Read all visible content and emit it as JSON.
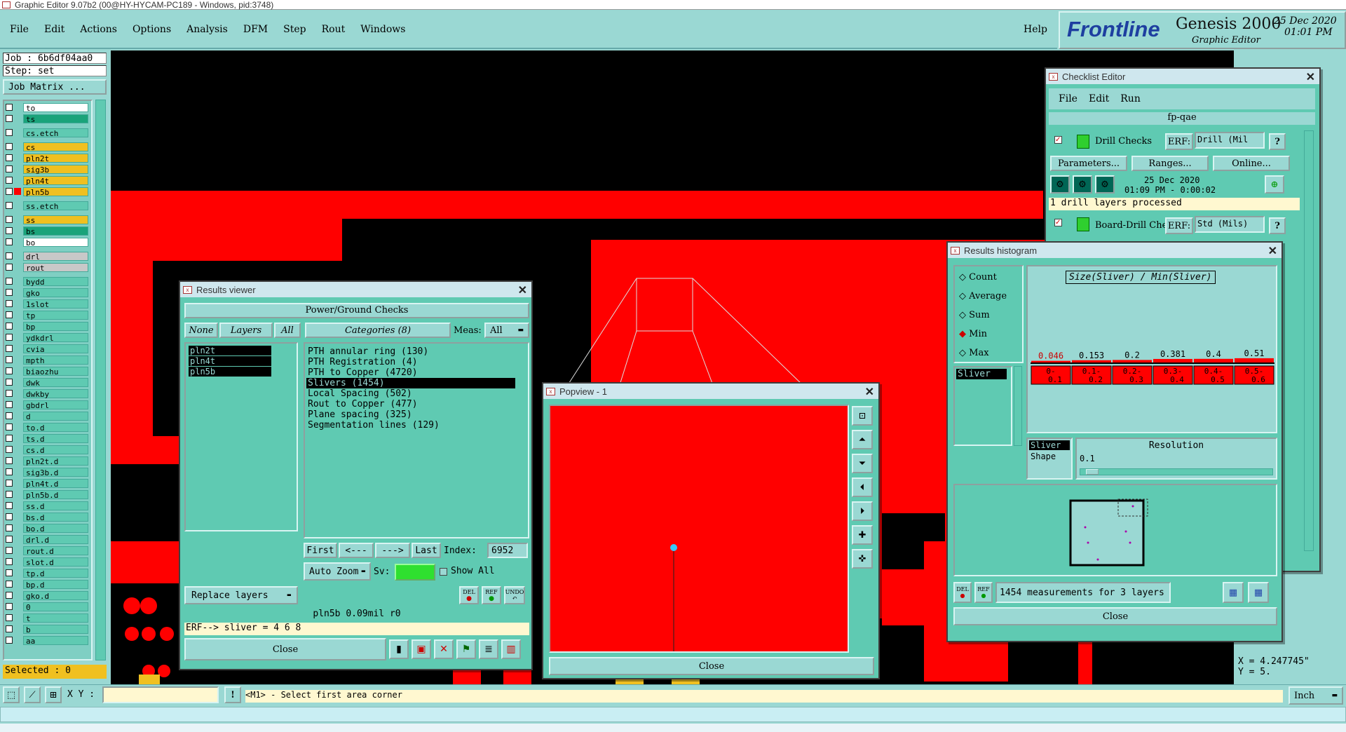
{
  "app": {
    "title": "Graphic Editor 9.07b2 (00@HY-HYCAM-PC189 - Windows, pid:3748)"
  },
  "menu": [
    "File",
    "Edit",
    "Actions",
    "Options",
    "Analysis",
    "DFM",
    "Step",
    "Rout",
    "Windows"
  ],
  "help": "Help",
  "brand": {
    "logo": "Frontline",
    "product": "Genesis 2000",
    "subtitle": "Graphic Editor",
    "date": "25 Dec 2020",
    "time": "01:01 PM"
  },
  "job": {
    "job_label": "Job : 6b6df04aa0",
    "step_label": "Step: set",
    "matrix_button": "Job Matrix ...",
    "selected": "Selected : 0"
  },
  "layers": [
    {
      "name": "to",
      "color": "#ffffff"
    },
    {
      "name": "ts",
      "color": "#1aa37a"
    },
    {
      "name": "cs.etch",
      "color": "#5fcab2"
    },
    {
      "name": "cs",
      "color": "#f0c020"
    },
    {
      "name": "pln2t",
      "color": "#f0c020"
    },
    {
      "name": "sig3b",
      "color": "#f0c020"
    },
    {
      "name": "pln4t",
      "color": "#f0c020"
    },
    {
      "name": "pln5b",
      "color": "#f0c020"
    },
    {
      "name": "ss.etch",
      "color": "#5fcab2"
    },
    {
      "name": "ss",
      "color": "#f0c020"
    },
    {
      "name": "bs",
      "color": "#1aa37a"
    },
    {
      "name": "bo",
      "color": "#ffffff"
    },
    {
      "name": "drl",
      "color": "#c8c8c8"
    },
    {
      "name": "rout",
      "color": "#c8c8c8"
    },
    {
      "name": "bydd",
      "color": "#5fcab2"
    },
    {
      "name": "gko",
      "color": "#5fcab2"
    },
    {
      "name": "1slot",
      "color": "#5fcab2"
    },
    {
      "name": "tp",
      "color": "#5fcab2"
    },
    {
      "name": "bp",
      "color": "#5fcab2"
    },
    {
      "name": "ydkdrl",
      "color": "#5fcab2"
    },
    {
      "name": "cvia",
      "color": "#5fcab2"
    },
    {
      "name": "mpth",
      "color": "#5fcab2"
    },
    {
      "name": "biaozhu",
      "color": "#5fcab2"
    },
    {
      "name": "dwk",
      "color": "#5fcab2"
    },
    {
      "name": "dwkby",
      "color": "#5fcab2"
    },
    {
      "name": "gbdrl",
      "color": "#5fcab2"
    },
    {
      "name": "d",
      "color": "#5fcab2"
    },
    {
      "name": "to.d",
      "color": "#5fcab2"
    },
    {
      "name": "ts.d",
      "color": "#5fcab2"
    },
    {
      "name": "cs.d",
      "color": "#5fcab2"
    },
    {
      "name": "pln2t.d",
      "color": "#5fcab2"
    },
    {
      "name": "sig3b.d",
      "color": "#5fcab2"
    },
    {
      "name": "pln4t.d",
      "color": "#5fcab2"
    },
    {
      "name": "pln5b.d",
      "color": "#5fcab2"
    },
    {
      "name": "ss.d",
      "color": "#5fcab2"
    },
    {
      "name": "bs.d",
      "color": "#5fcab2"
    },
    {
      "name": "bo.d",
      "color": "#5fcab2"
    },
    {
      "name": "drl.d",
      "color": "#5fcab2"
    },
    {
      "name": "rout.d",
      "color": "#5fcab2"
    },
    {
      "name": "slot.d",
      "color": "#5fcab2"
    },
    {
      "name": "tp.d",
      "color": "#5fcab2"
    },
    {
      "name": "bp.d",
      "color": "#5fcab2"
    },
    {
      "name": "gko.d",
      "color": "#5fcab2"
    },
    {
      "name": "0",
      "color": "#5fcab2"
    },
    {
      "name": "t",
      "color": "#5fcab2"
    },
    {
      "name": "b",
      "color": "#5fcab2"
    },
    {
      "name": "aa",
      "color": "#5fcab2"
    }
  ],
  "results_viewer": {
    "title": "Results viewer",
    "header": "Power/Ground Checks",
    "none": "None",
    "layers": "Layers",
    "all": "All",
    "categories_header": "Categories (8)",
    "meas_label": "Meas:",
    "meas_value": "All",
    "layer_list": [
      "pln2t",
      "pln4t",
      "pln5b"
    ],
    "categories": [
      "PTH annular ring (130)",
      "PTH Registration (4)",
      "PTH to Copper (4720)",
      "Slivers (1454)",
      "Local Spacing (502)",
      "Rout to Copper (477)",
      "Plane spacing (325)",
      "Segmentation lines (129)"
    ],
    "nav": {
      "first": "First",
      "prev": "<---",
      "next": "--->",
      "last": "Last",
      "index_label": "Index:",
      "index_value": "6952"
    },
    "auto_zoom": "Auto Zoom",
    "sv": "Sv:",
    "show_all": "Show All",
    "replace_layers": "Replace layers",
    "del": "DEL",
    "ref": "REF",
    "undo": "UNDO",
    "status": "pln5b 0.09mil  r0",
    "erf": "ERF--> sliver = 4 6 8",
    "close": "Close"
  },
  "popview": {
    "title": "Popview - 1",
    "close": "Close"
  },
  "checklist": {
    "title": "Checklist Editor",
    "menu": [
      "File",
      "Edit",
      "Run"
    ],
    "name": "fp-qae",
    "check1": {
      "name": "Drill Checks",
      "erf_label": "ERF:",
      "erf_value": "Drill (Mil",
      "date": "25 Dec 2020",
      "time": "01:09 PM - 0:00:02",
      "message": "1 drill layers processed"
    },
    "buttons": [
      "Parameters...",
      "Ranges...",
      "Online..."
    ],
    "check2": {
      "name": "Board-Drill Che",
      "erf_label": "ERF:",
      "erf_value": "Std (Mils)"
    },
    "question": "?"
  },
  "histogram": {
    "title": "Results histogram",
    "stats": [
      "Count",
      "Average",
      "Sum",
      "Min",
      "Max"
    ],
    "selected_stat": "Min",
    "chart_title": "Size(Sliver) / Min(Sliver)",
    "list_item": "Sliver",
    "shape_label": "Sliver",
    "shape_sub": "Shape",
    "resolution_label": "Resolution",
    "resolution_value": "0.1",
    "summary": "1454 measurements for 3 layers",
    "close": "Close",
    "del": "DEL",
    "ref": "REF"
  },
  "chart_data": {
    "type": "bar",
    "title": "Size(Sliver) / Min(Sliver)",
    "categories": [
      "0-0.1",
      "0.1-0.2",
      "0.2-0.3",
      "0.3-0.4",
      "0.4-0.5",
      "0.5-0.6"
    ],
    "values": [
      0.046,
      0.153,
      0.2,
      0.381,
      0.4,
      0.51
    ],
    "value_labels": [
      "0.046",
      "0.153",
      "0.2",
      "0.381",
      "0.4",
      "0.51"
    ],
    "bar_color": "#ff0000"
  },
  "statusbar": {
    "xy_label": "X Y :",
    "prompt": "<M1> - Select first area corner",
    "units": "Inch",
    "coord_x": "X = 4.247745\"",
    "coord_y": "Y = 5."
  }
}
